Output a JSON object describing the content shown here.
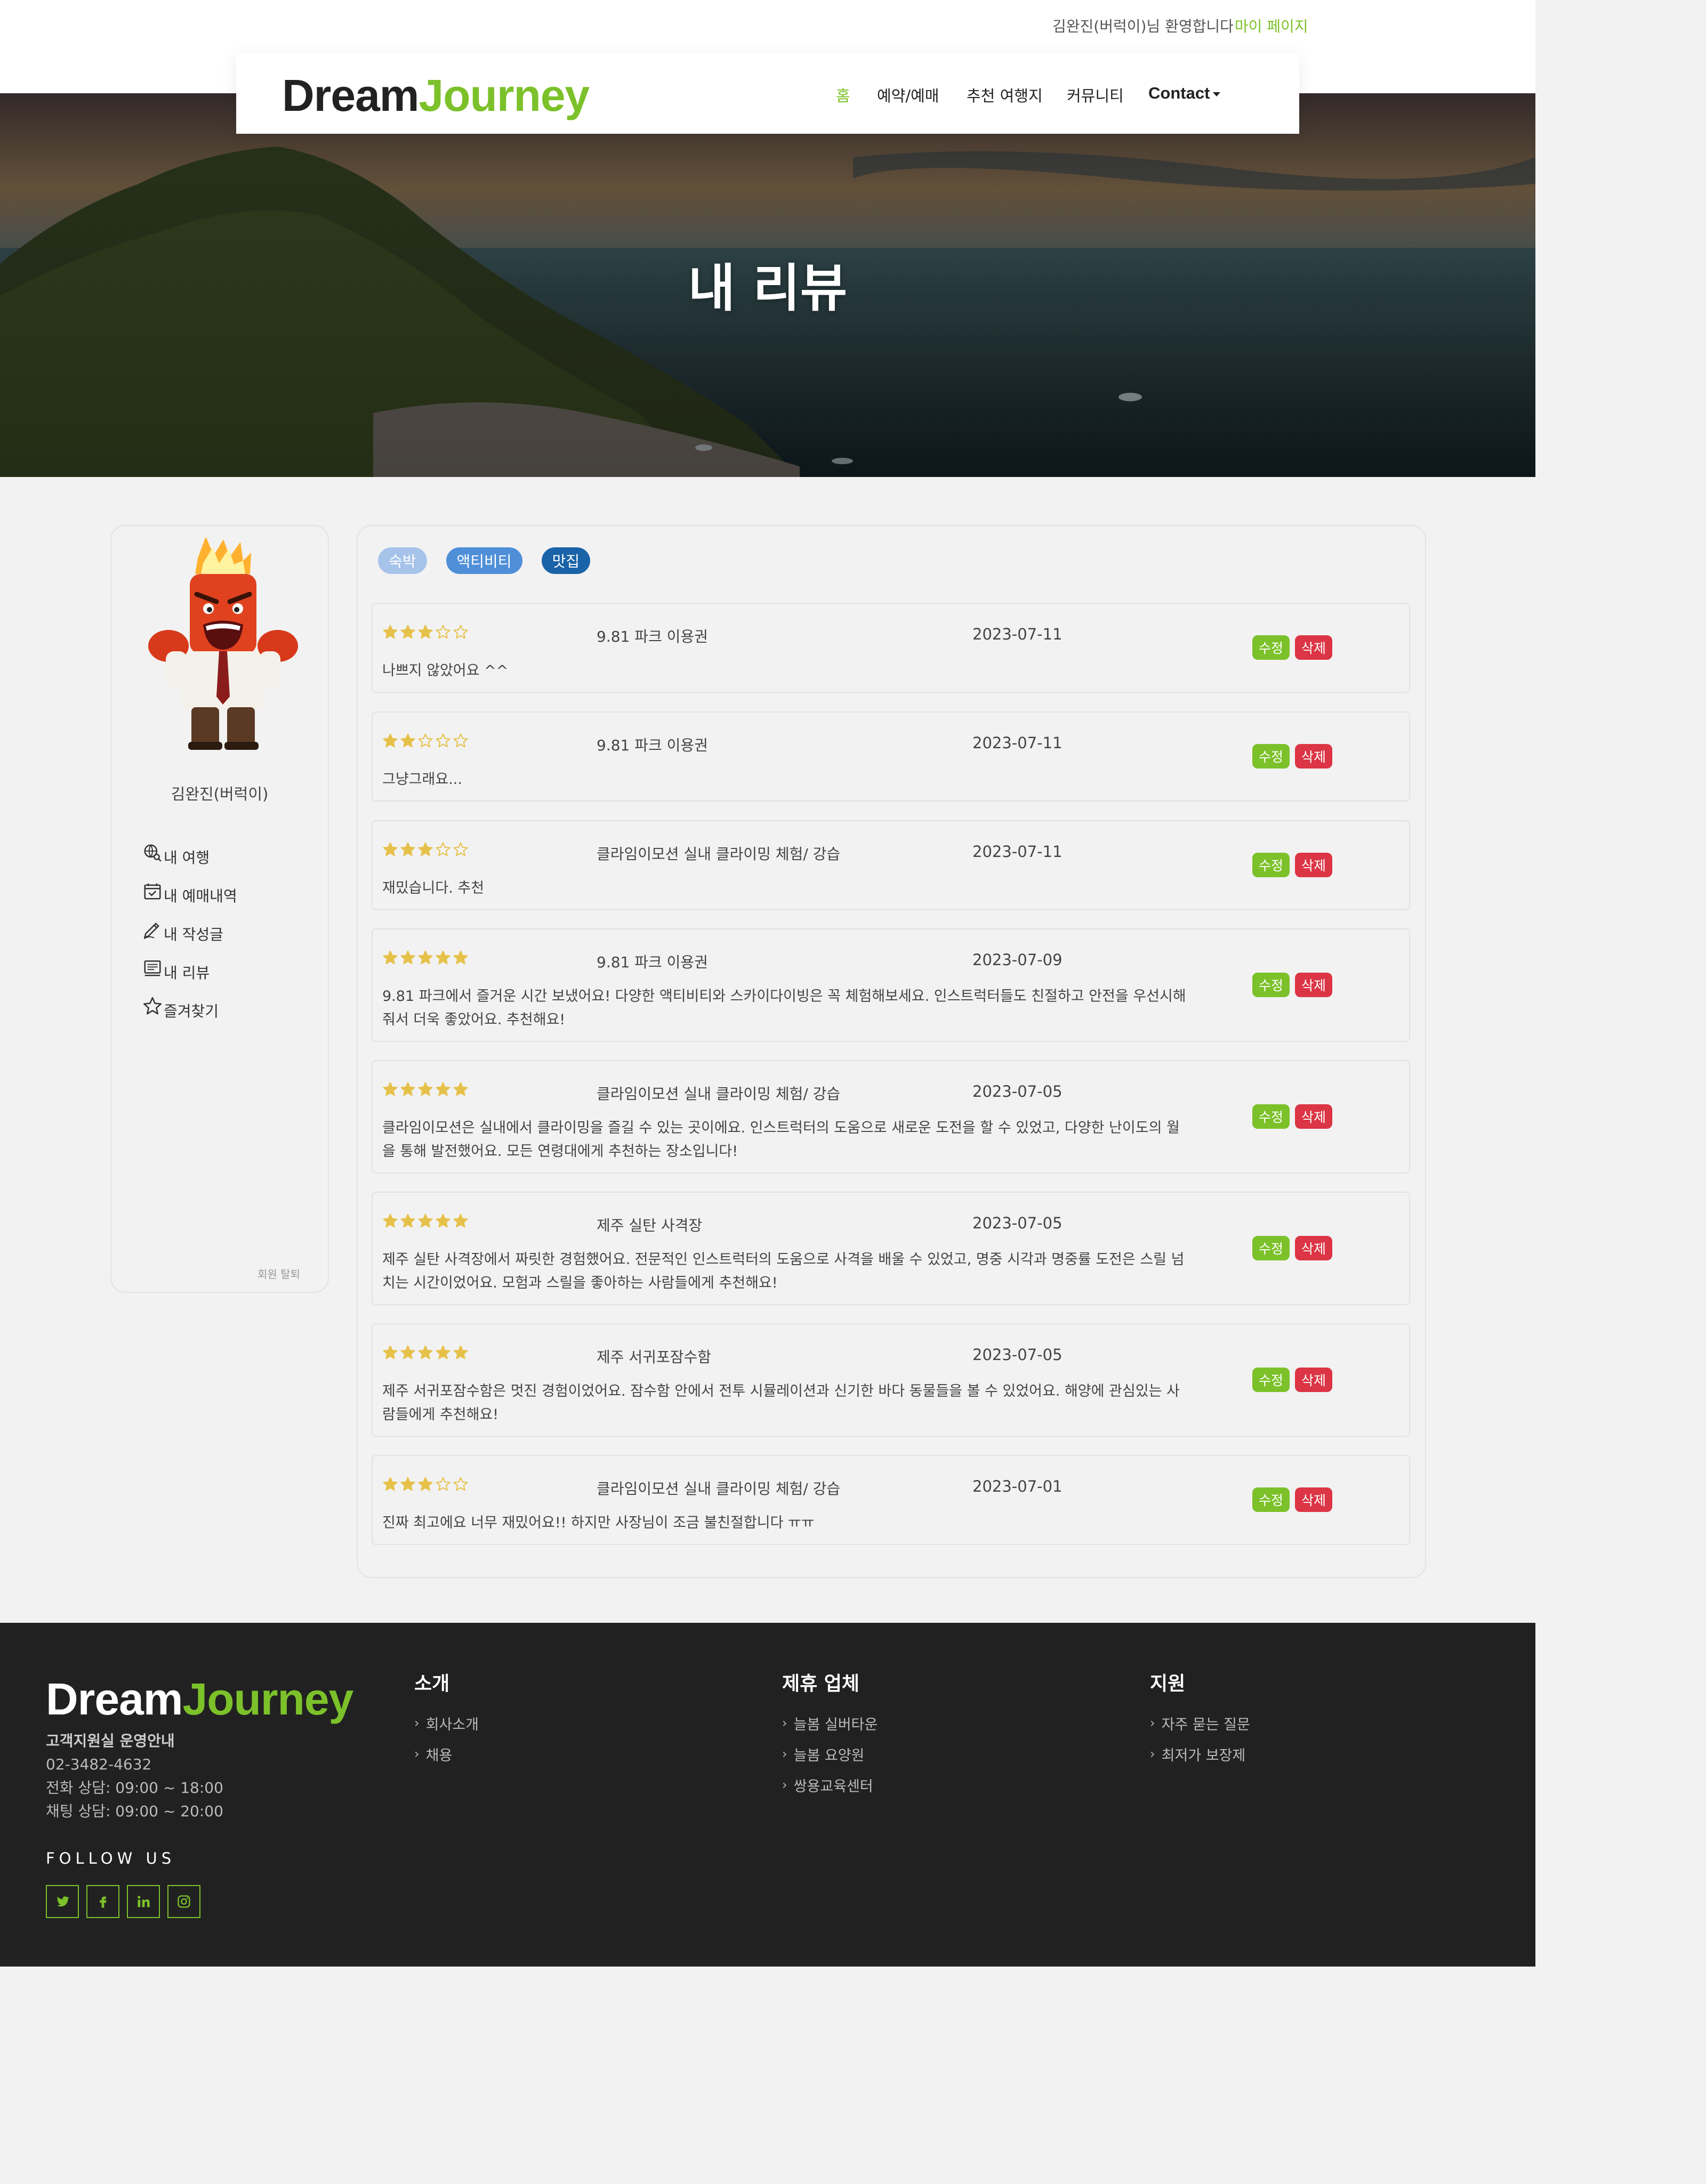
{
  "header": {
    "welcome_text": "김완진(버럭이)님 환영합니다",
    "mypage_link": "마이 페이지",
    "logo_dream": "Dream",
    "logo_journey": "Journey",
    "nav": {
      "home": "홈",
      "booking": "예약/예매",
      "recommend": "추천 여행지",
      "community": "커뮤니티",
      "contact": "Contact"
    }
  },
  "hero": {
    "title": "내 리뷰"
  },
  "sidebar": {
    "username": "김완진(버럭이)",
    "menu": [
      "내 여행",
      "내 예매내역",
      "내 작성글",
      "내 리뷰",
      "즐겨찾기"
    ],
    "withdraw": "회원 탈퇴"
  },
  "filters": [
    {
      "label": "숙박",
      "color": "#a6c3ea"
    },
    {
      "label": "액티비티",
      "color": "#4f8fd8"
    },
    {
      "label": "맛집",
      "color": "#1a63a8"
    }
  ],
  "reviews": [
    {
      "rating": 3,
      "title": "9.81 파크 이용권",
      "date": "2023-07-11",
      "body": "나쁘지 않았어요 ^^"
    },
    {
      "rating": 2,
      "title": "9.81 파크 이용권",
      "date": "2023-07-11",
      "body": "그냥그래요..."
    },
    {
      "rating": 3,
      "title": "클라임이모션 실내 클라이밍 체험/ 강습",
      "date": "2023-07-11",
      "body": "재밌습니다. 추천"
    },
    {
      "rating": 5,
      "title": "9.81 파크 이용권",
      "date": "2023-07-09",
      "body": "9.81 파크에서 즐거운 시간 보냈어요! 다양한 액티비티와 스카이다이빙은 꼭 체험해보세요. 인스트럭터들도 친절하고 안전을 우선시해 줘서 더욱 좋았어요. 추천해요!"
    },
    {
      "rating": 5,
      "title": "클라임이모션 실내 클라이밍 체험/ 강습",
      "date": "2023-07-05",
      "body": "클라임이모션은 실내에서 클라이밍을 즐길 수 있는 곳이에요. 인스트럭터의 도움으로 새로운 도전을 할 수 있었고, 다양한 난이도의 월을 통해 발전했어요. 모든 연령대에게 추천하는 장소입니다!"
    },
    {
      "rating": 5,
      "title": "제주 실탄 사격장",
      "date": "2023-07-05",
      "body": "제주 실탄 사격장에서 짜릿한 경험했어요. 전문적인 인스트럭터의 도움으로 사격을 배울 수 있었고, 명중 시각과 명중률 도전은 스릴 넘치는 시간이었어요. 모험과 스릴을 좋아하는 사람들에게 추천해요!"
    },
    {
      "rating": 5,
      "title": "제주 서귀포잠수함",
      "date": "2023-07-05",
      "body": "제주 서귀포잠수함은 멋진 경험이었어요. 잠수함 안에서 전투 시뮬레이션과 신기한 바다 동물들을 볼 수 있었어요. 해양에 관심있는 사람들에게 추천해요!"
    },
    {
      "rating": 3,
      "title": "클라임이모션 실내 클라이밍 체험/ 강습",
      "date": "2023-07-01",
      "body": "진짜 최고에요 너무 재밌어요!! 하지만 사장님이 조금 불친절합니다 ㅠㅠ"
    }
  ],
  "review_actions": {
    "edit": "수정",
    "delete": "삭제"
  },
  "footer": {
    "logo_dream": "Dream",
    "logo_journey": "Journey",
    "support_head": "고객지원실 운영안내",
    "phone": "02-3482-4632",
    "phone_hours": "전화 상담: 09:00 ~ 18:00",
    "chat_hours": "채팅 상담: 09:00 ~ 20:00",
    "follow_us": "FOLLOW US",
    "socials": [
      "twitter-icon",
      "facebook-icon",
      "linkedin-icon",
      "instagram-icon"
    ],
    "columns": [
      {
        "heading": "소개",
        "links": [
          "회사소개",
          "채용"
        ]
      },
      {
        "heading": "제휴 업체",
        "links": [
          "늘봄 실버타운",
          "늘봄 요양원",
          "쌍용교육센터"
        ]
      },
      {
        "heading": "지원",
        "links": [
          "자주 묻는 질문",
          "최저가 보장제"
        ]
      }
    ]
  },
  "colors": {
    "accent": "#7cc12a",
    "danger": "#dc3545",
    "star": "#e6c14a",
    "footer_bg": "#212121"
  }
}
